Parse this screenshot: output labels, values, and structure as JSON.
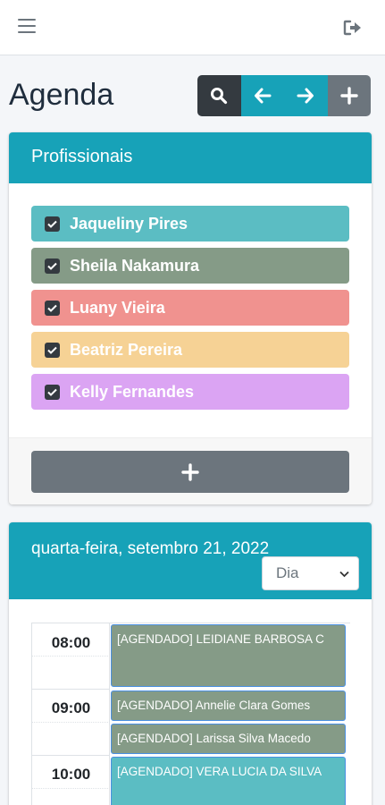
{
  "topbar": {
    "menu_icon": "bars-icon",
    "logout_icon": "sign-out-icon"
  },
  "page": {
    "title": "Agenda"
  },
  "toolbar": {
    "buttons": [
      {
        "name": "search-button",
        "icon": "search-icon",
        "color": "#343a40"
      },
      {
        "name": "prev-button",
        "icon": "arrow-left-icon",
        "color": "#17a2b8"
      },
      {
        "name": "next-button",
        "icon": "arrow-right-icon",
        "color": "#17a2b8"
      },
      {
        "name": "add-button",
        "icon": "plus-icon",
        "color": "#6c757d"
      }
    ]
  },
  "professionals": {
    "title": "Profissionais",
    "items": [
      {
        "name": "Jaqueliny Pires",
        "color": "#5bbdc3",
        "checked": true
      },
      {
        "name": "Sheila Nakamura",
        "color": "#859b87",
        "checked": true
      },
      {
        "name": "Luany Vieira",
        "color": "#f0928f",
        "checked": true
      },
      {
        "name": "Beatriz Pereira",
        "color": "#f6d295",
        "checked": true
      },
      {
        "name": "Kelly Fernandes",
        "color": "#dba4f3",
        "checked": true
      }
    ],
    "add_icon": "plus-icon"
  },
  "agenda": {
    "date": "quarta-feira, setembro 21, 2022",
    "view": {
      "selected": "Dia"
    },
    "times": [
      "08:00",
      "09:00",
      "10:00"
    ],
    "events": [
      {
        "text": "[AGENDADO] LEIDIANE BARBOSA C",
        "color": "#859b87"
      },
      {
        "text": "[AGENDADO] Annelie Clara Gomes",
        "color": "#859b87"
      },
      {
        "text": "[AGENDADO] Larissa Silva Macedo",
        "color": "#859b87"
      },
      {
        "text": "[AGENDADO] VERA LUCIA DA SILVA",
        "color": "#5bbdc3"
      }
    ]
  }
}
